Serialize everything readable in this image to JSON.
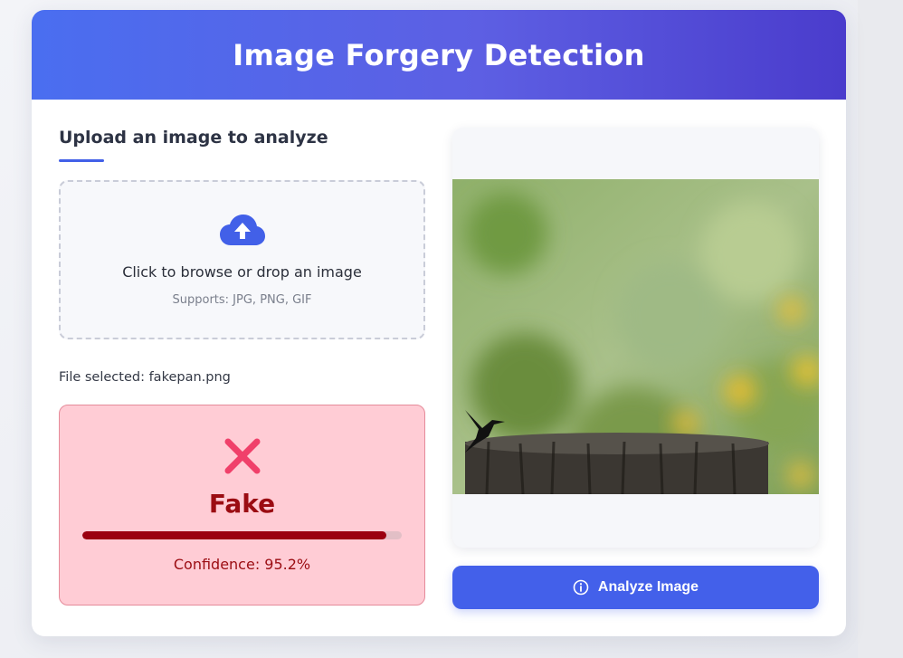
{
  "app": {
    "title": "Image Forgery Detection"
  },
  "upload": {
    "heading": "Upload an image to analyze",
    "dropzone_text": "Click to browse or drop an image",
    "supports_text": "Supports: JPG, PNG, GIF",
    "file_selected": "File selected: fakepan.png"
  },
  "result": {
    "label": "Fake",
    "confidence_text": "Confidence: 95.2%",
    "confidence_value": 0.952,
    "icon": "x-mark-icon",
    "colors": {
      "accent": "#9b0c12",
      "background": "#ffccd5",
      "icon": "#f0406a"
    }
  },
  "preview": {
    "icon_bird": "hummingbird-silhouette"
  },
  "actions": {
    "analyze_label": "Analyze Image",
    "analyze_icon": "info-circle-icon"
  },
  "theme": {
    "primary": "#4360ea"
  }
}
